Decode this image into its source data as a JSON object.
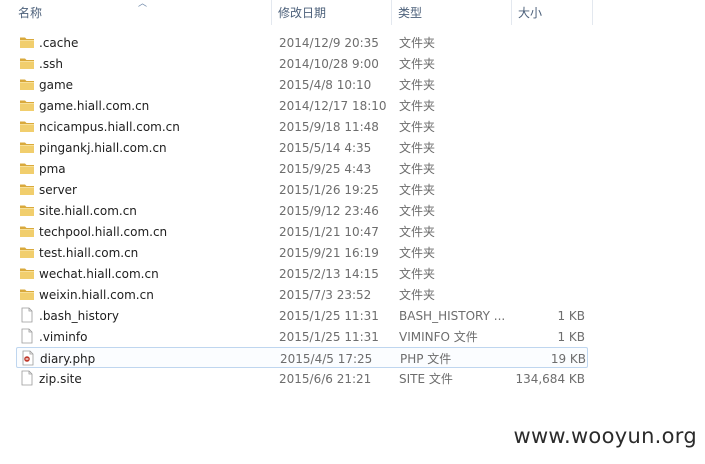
{
  "columns": {
    "name": "名称",
    "date": "修改日期",
    "type": "类型",
    "size": "大小"
  },
  "files": [
    {
      "name": ".cache",
      "date": "2014/12/9 20:35",
      "type": "文件夹",
      "size": "",
      "icon": "folder-icon"
    },
    {
      "name": ".ssh",
      "date": "2014/10/28 9:00",
      "type": "文件夹",
      "size": "",
      "icon": "folder-icon"
    },
    {
      "name": "game",
      "date": "2015/4/8 10:10",
      "type": "文件夹",
      "size": "",
      "icon": "folder-icon"
    },
    {
      "name": "game.hiall.com.cn",
      "date": "2014/12/17 18:10",
      "type": "文件夹",
      "size": "",
      "icon": "folder-icon"
    },
    {
      "name": "ncicampus.hiall.com.cn",
      "date": "2015/9/18 11:48",
      "type": "文件夹",
      "size": "",
      "icon": "folder-icon"
    },
    {
      "name": "pingankj.hiall.com.cn",
      "date": "2015/5/14 4:35",
      "type": "文件夹",
      "size": "",
      "icon": "folder-icon"
    },
    {
      "name": "pma",
      "date": "2015/9/25 4:43",
      "type": "文件夹",
      "size": "",
      "icon": "folder-icon"
    },
    {
      "name": "server",
      "date": "2015/1/26 19:25",
      "type": "文件夹",
      "size": "",
      "icon": "folder-icon"
    },
    {
      "name": "site.hiall.com.cn",
      "date": "2015/9/12 23:46",
      "type": "文件夹",
      "size": "",
      "icon": "folder-icon"
    },
    {
      "name": "techpool.hiall.com.cn",
      "date": "2015/1/21 10:47",
      "type": "文件夹",
      "size": "",
      "icon": "folder-icon"
    },
    {
      "name": "test.hiall.com.cn",
      "date": "2015/9/21 16:19",
      "type": "文件夹",
      "size": "",
      "icon": "folder-icon"
    },
    {
      "name": "wechat.hiall.com.cn",
      "date": "2015/2/13 14:15",
      "type": "文件夹",
      "size": "",
      "icon": "folder-icon"
    },
    {
      "name": "weixin.hiall.com.cn",
      "date": "2015/7/3 23:52",
      "type": "文件夹",
      "size": "",
      "icon": "folder-icon"
    },
    {
      "name": ".bash_history",
      "date": "2015/1/25 11:31",
      "type": "BASH_HISTORY ...",
      "size": "1 KB",
      "icon": "file-icon"
    },
    {
      "name": ".viminfo",
      "date": "2015/1/25 11:31",
      "type": "VIMINFO 文件",
      "size": "1 KB",
      "icon": "file-icon"
    },
    {
      "name": "diary.php",
      "date": "2015/4/5 17:25",
      "type": "PHP 文件",
      "size": "19 KB",
      "icon": "php-file-icon",
      "selected": true
    },
    {
      "name": "zip.site",
      "date": "2015/6/6 21:21",
      "type": "SITE 文件",
      "size": "134,684 KB",
      "icon": "file-icon"
    }
  ],
  "watermark": "www.wooyun.org",
  "colors": {
    "header_text": "#4c607a",
    "folder": "#e8c062",
    "selection_border": "#bfd6ef",
    "php_accent": "#c0392b"
  }
}
